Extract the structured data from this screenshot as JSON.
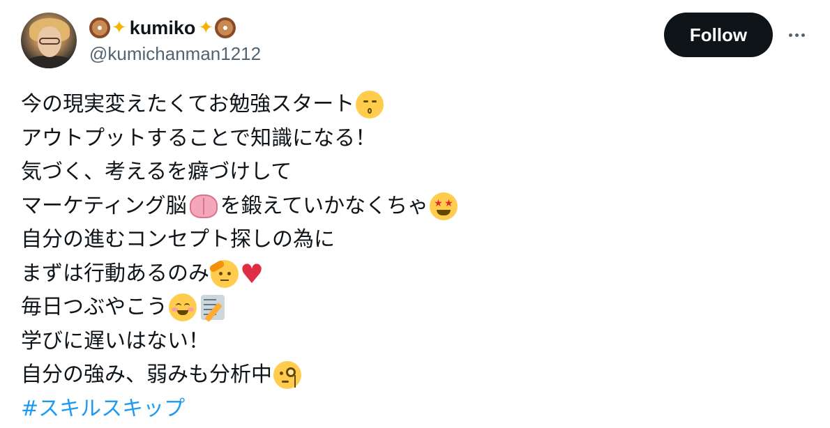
{
  "author": {
    "display_name": "kumiko",
    "name_decoration_left": "🍩✨",
    "name_decoration_right": "✨🍩",
    "handle": "@kumichanman1212",
    "avatar_icon": "profile-photo"
  },
  "actions": {
    "follow_label": "Follow",
    "more_icon": "more-horizontal-icon"
  },
  "tweet": {
    "lines": [
      {
        "text": "今の現実変えたくてお勉強スタート",
        "emoji": [
          "kissing-face"
        ]
      },
      {
        "text": "アウトプットすることで知識になる！",
        "emoji": []
      },
      {
        "text": "気づく、考えるを癖づけして",
        "emoji": []
      },
      {
        "text_before": "マーケティング脳",
        "text_after": "を鍛えていかなくちゃ",
        "emoji": [
          "brain",
          "star-struck"
        ]
      },
      {
        "text": "自分の進むコンセプト探しの為に",
        "emoji": []
      },
      {
        "text": "まずは行動あるのみ",
        "emoji": [
          "saluting-face",
          "red-heart"
        ]
      },
      {
        "text": "毎日つぶやこう",
        "emoji": [
          "smiling-face-with-smiling-eyes",
          "memo"
        ]
      },
      {
        "text": "学びに遅いはない！",
        "emoji": []
      },
      {
        "text": "自分の強み、弱みも分析中",
        "emoji": [
          "face-with-monocle"
        ]
      }
    ],
    "hashtag": "#スキルスキップ"
  },
  "colors": {
    "text_primary": "#0f1419",
    "text_secondary": "#536471",
    "follow_bg": "#0f1419",
    "hashtag": "#1d9bf0"
  }
}
